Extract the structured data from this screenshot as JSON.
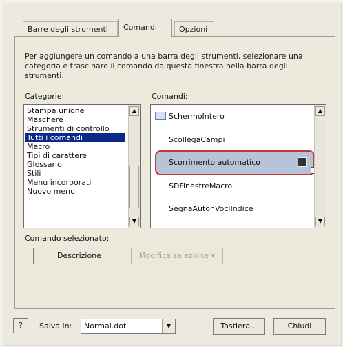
{
  "tabs": [
    {
      "label": "Barre degli strumenti"
    },
    {
      "label": "Comandi"
    },
    {
      "label": "Opzioni"
    }
  ],
  "description": "Per aggiungere un comando a una barra degli strumenti, selezionare una categoria e trascinare il comando da questa finestra nella barra degli strumenti.",
  "categories": {
    "label": "Categorie:",
    "selected": "Tutti i comandi",
    "items": [
      "Stampa unione",
      "Maschere",
      "Strumenti di controllo",
      "Tutti i comandi",
      "Macro",
      "Tipi di carattere",
      "Glossario",
      "Stili",
      "Menu incorporati",
      "Nuovo menu"
    ]
  },
  "commands": {
    "label": "Comandi:",
    "items": [
      "SchermoIntero",
      "ScollegaCampi",
      "Scorrimento automatico",
      "SDFinestreMacro",
      "SegnaAutonVociIndice"
    ],
    "highlighted": "Scorrimento automatico"
  },
  "selected_command": {
    "label": "Comando selezionato:",
    "description_button": "Descrizione",
    "modify_button": "Modifica selezione"
  },
  "footer": {
    "help_icon_text": "?",
    "save_in_label": "Salva in:",
    "save_in_value": "Normal.dot",
    "keyboard_button": "Tastiera...",
    "close_button": "Chiudi"
  }
}
